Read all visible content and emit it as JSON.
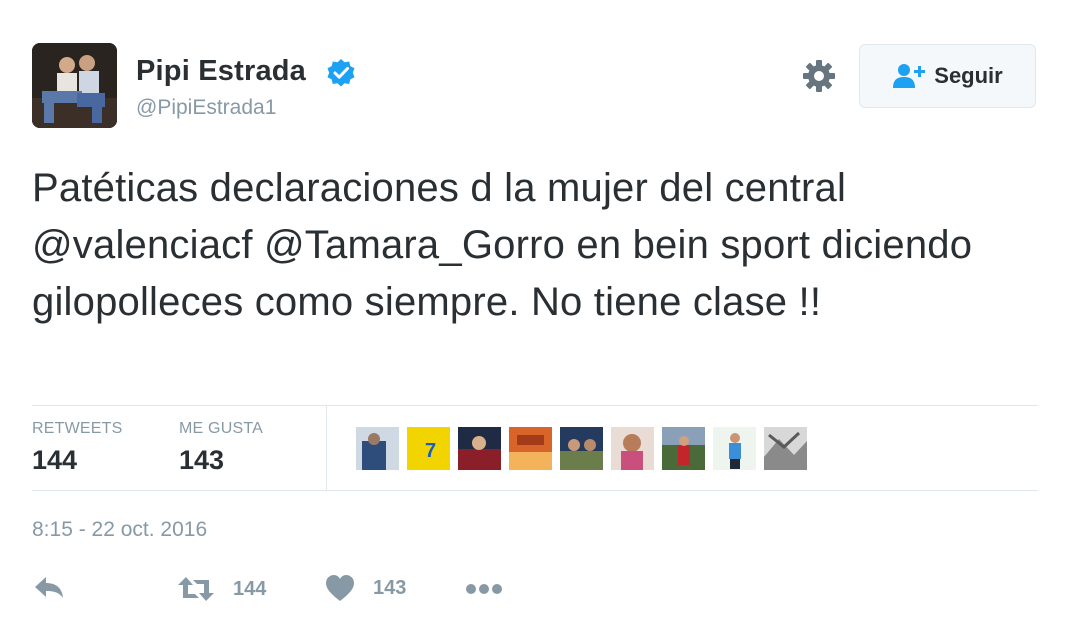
{
  "user": {
    "name": "Pipi Estrada",
    "handle": "@PipiEstrada1",
    "verified": true
  },
  "follow_button": {
    "label": "Seguir"
  },
  "tweet": {
    "text": "Patéticas declaraciones d la mujer del central @valenciacf @Tamara_Gorro en bein sport diciendo gilopolleces como siempre. No tiene clase !!",
    "timestamp": "8:15 - 22 oct. 2016"
  },
  "stats": {
    "retweets_label": "RETWEETS",
    "retweets_value": "144",
    "likes_label": "ME GUSTA",
    "likes_value": "143"
  },
  "actions": {
    "retweet_count": "144",
    "like_count": "143"
  },
  "icons": [
    "verified-icon",
    "gear-icon",
    "follow-user-icon",
    "reply-icon",
    "retweet-icon",
    "heart-icon",
    "more-icon"
  ],
  "colors": {
    "text": "#292f33",
    "secondary": "#8899a6",
    "verified": "#1da1f2",
    "border": "#e1e8ed",
    "button_bg": "#f5f8fa"
  }
}
